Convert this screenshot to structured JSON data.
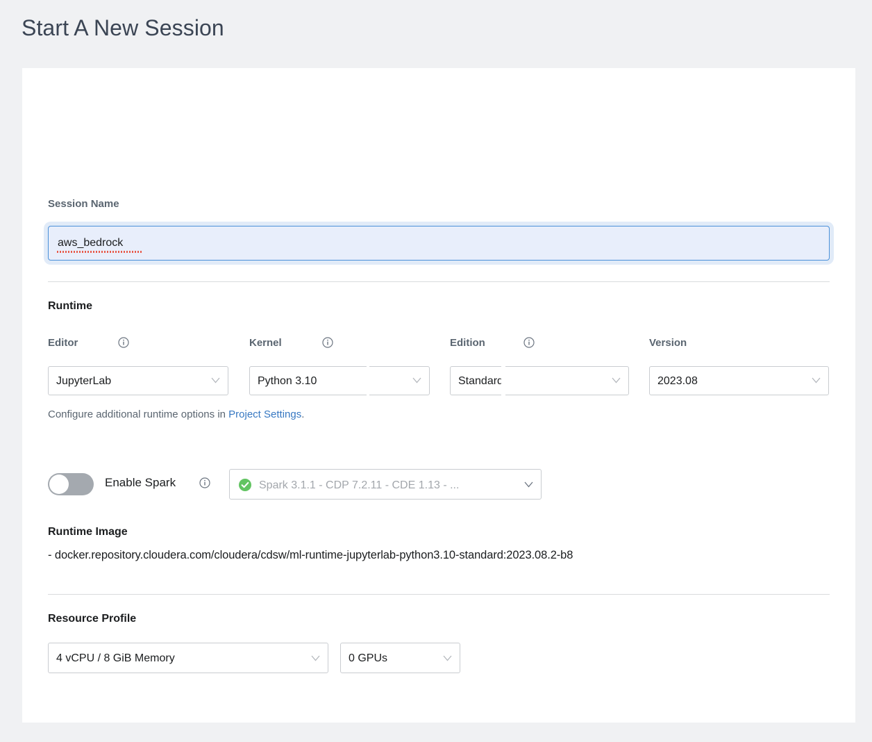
{
  "page": {
    "title": "Start A New Session"
  },
  "session_name": {
    "label": "Session Name",
    "value": "aws_bedrock",
    "placeholder": "Session Name"
  },
  "runtime": {
    "heading": "Runtime",
    "helper_prefix": "Configure additional runtime options in ",
    "helper_link": "Project Settings",
    "helper_suffix": ".",
    "fields": [
      {
        "label": "Editor",
        "value": "JupyterLab",
        "has_info": true
      },
      {
        "label": "Kernel",
        "value": "Python 3.10",
        "has_info": true
      },
      {
        "label": "Edition",
        "value": "Standard",
        "has_info": true
      },
      {
        "label": "Version",
        "value": "2023.08",
        "has_info": false
      }
    ]
  },
  "spark": {
    "label": "Enable Spark",
    "enabled": false,
    "status_icon": "check-circle-icon",
    "version": "Spark 3.1.1 - CDP 7.2.11 - CDE 1.13 - ..."
  },
  "runtime_image": {
    "heading": "Runtime Image",
    "value": "- docker.repository.cloudera.com/cloudera/cdsw/ml-runtime-jupyterlab-python3.10-standard:2023.08.2-b8"
  },
  "resource_profile": {
    "heading": "Resource Profile",
    "cpu_memory": "4 vCPU / 8 GiB Memory",
    "gpus": "0 GPUs"
  },
  "colors": {
    "page_background": "#f0f1f3",
    "card_background": "#ffffff",
    "title_text": "#3b4554",
    "label_text": "#5a6570",
    "body_text": "#1b1d1f",
    "link": "#3778c2",
    "input_focus_border": "#4a90d9",
    "input_focus_background": "#e8eefb",
    "toggle_off": "#a4a9af",
    "status_green": "#62c462",
    "border": "#c9ccd0",
    "divider": "#d9dbdd",
    "spellcheck_underline": "#e8594a"
  },
  "icons": {
    "info": "info-circle-icon",
    "chevron": "chevron-down-icon",
    "check": "check-circle-icon"
  }
}
